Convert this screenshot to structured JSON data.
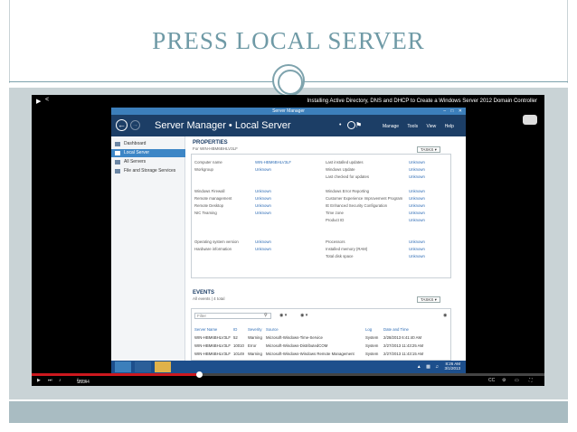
{
  "slide": {
    "title": "PRESS LOCAL SERVER"
  },
  "player": {
    "video_title": "Installing Active Directory, DNS and DHCP to Create a Windows Server 2012 Domain Controller",
    "time_current": "9:03",
    "time_total": "27:44",
    "progress": 0.327,
    "icons": [
      "play-icon",
      "share-icon",
      "next-icon",
      "volume-icon",
      "cc-icon",
      "settings-icon",
      "fullscreen-icon"
    ]
  },
  "window": {
    "title": "Server Manager",
    "breadcrumb": "Server Manager • Local Server",
    "menu": [
      "Manage",
      "Tools",
      "View",
      "Help"
    ]
  },
  "nav": {
    "items": [
      {
        "label": "Dashboard",
        "active": false
      },
      {
        "label": "Local Server",
        "active": true
      },
      {
        "label": "All Servers",
        "active": false
      },
      {
        "label": "File and Storage Services",
        "active": false
      }
    ]
  },
  "properties": {
    "title": "PROPERTIES",
    "subtitle": "For WIN-HBM6BHLV3LF",
    "tasks_label": "TASKS",
    "left": [
      {
        "label": "Computer name",
        "value": "WIN-HBM6BHLV3LF"
      },
      {
        "label": "Workgroup",
        "value": "Unknown"
      },
      {
        "label": "",
        "value": ""
      },
      {
        "label": "",
        "value": ""
      },
      {
        "label": "Windows Firewall",
        "value": "Unknown"
      },
      {
        "label": "Remote management",
        "value": "Unknown"
      },
      {
        "label": "Remote Desktop",
        "value": "Unknown"
      },
      {
        "label": "NIC Teaming",
        "value": "Unknown"
      },
      {
        "label": "",
        "value": ""
      },
      {
        "label": "",
        "value": ""
      },
      {
        "label": "",
        "value": ""
      },
      {
        "label": "Operating system version",
        "value": "Unknown"
      },
      {
        "label": "Hardware information",
        "value": "Unknown"
      }
    ],
    "right": [
      {
        "label": "Last installed updates",
        "value": "Unknown"
      },
      {
        "label": "Windows Update",
        "value": "Unknown"
      },
      {
        "label": "Last checked for updates",
        "value": "Unknown"
      },
      {
        "label": "",
        "value": ""
      },
      {
        "label": "Windows Error Reporting",
        "value": "Unknown"
      },
      {
        "label": "Customer Experience Improvement Program",
        "value": "Unknown"
      },
      {
        "label": "IE Enhanced Security Configuration",
        "value": "Unknown"
      },
      {
        "label": "Time zone",
        "value": "Unknown"
      },
      {
        "label": "Product ID",
        "value": "Unknown"
      },
      {
        "label": "",
        "value": ""
      },
      {
        "label": "",
        "value": ""
      },
      {
        "label": "Processors",
        "value": "Unknown"
      },
      {
        "label": "Installed memory (RAM)",
        "value": "Unknown"
      },
      {
        "label": "Total disk space",
        "value": "Unknown"
      }
    ]
  },
  "events": {
    "title": "EVENTS",
    "subtitle": "All events | 4 total",
    "tasks_label": "TASKS",
    "filter_placeholder": "Filter",
    "columns": [
      "Server Name",
      "ID",
      "Severity",
      "Source",
      "Log",
      "Date and Time"
    ],
    "rows": [
      [
        "WIN-HBM6BHLV3LF",
        "52",
        "Warning",
        "Microsoft-Windows-Time-Service",
        "System",
        "2/28/2013 6:41:40 AM"
      ],
      [
        "WIN-HBM6BHLV3LF",
        "10010",
        "Error",
        "Microsoft-Windows-DistributedCOM",
        "System",
        "2/27/2013 11:43:25 AM"
      ],
      [
        "WIN-HBM6BHLV3LF",
        "10149",
        "Warning",
        "Microsoft-Windows-Windows Remote Management",
        "System",
        "2/27/2013 11:43:15 AM"
      ]
    ]
  },
  "taskbar": {
    "time": "8:26 AM",
    "date": "3/1/2013"
  },
  "colors": {
    "title_teal": "#6f9aa6",
    "sm_header": "#1c3e66",
    "nav_active": "#3d86c6",
    "link_blue": "#2f6db5",
    "taskbar": "#1d4f8c",
    "progress_red": "#cc181e"
  }
}
